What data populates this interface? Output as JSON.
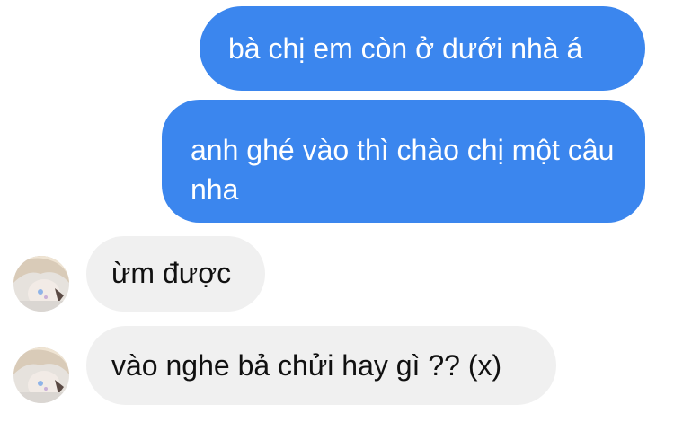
{
  "conversation": {
    "messages": [
      {
        "direction": "outgoing",
        "text": "bà chị em còn ở dưới nhà á"
      },
      {
        "direction": "outgoing",
        "text": "anh ghé vào thì chào chị một câu nha"
      },
      {
        "direction": "incoming",
        "text": "ừm được"
      },
      {
        "direction": "incoming",
        "text": "vào nghe bả chửi hay gì ?? (x)"
      }
    ],
    "colors": {
      "outgoing_bubble": "#3b86ee",
      "incoming_bubble": "#f0f0f0"
    }
  }
}
